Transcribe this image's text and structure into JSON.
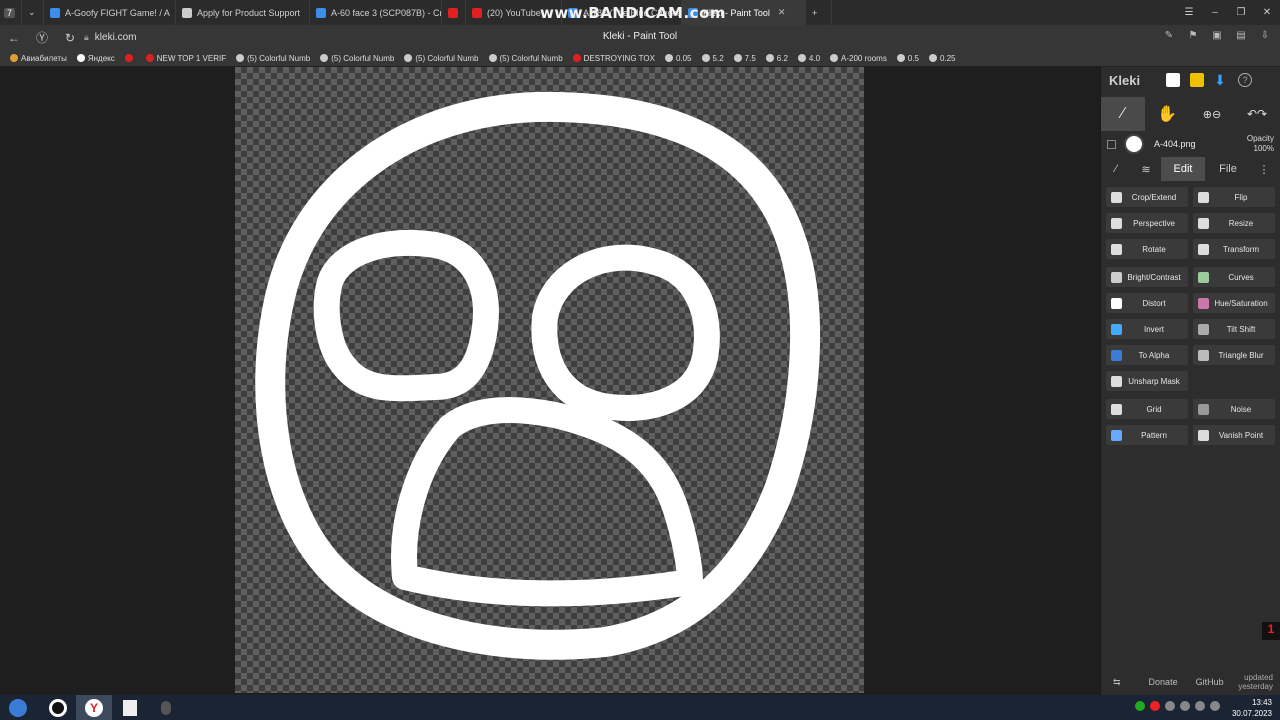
{
  "browser": {
    "tabs": [
      {
        "title": "A-Goofy FIGHT Game! / A",
        "color": "#3b8eea"
      },
      {
        "title": "Apply for Product Support",
        "color": "#cccccc"
      },
      {
        "title": "A-60 face 3 (SCP087B) - Cr",
        "color": "#3b8eea"
      },
      {
        "title": "",
        "color": "#e02020"
      },
      {
        "title": "(20) YouTube",
        "color": "#e02020"
      },
      {
        "title": "A-185 (The Blue Checker)",
        "color": "#3b8eea"
      },
      {
        "title": "Kleki - Paint Tool",
        "color": "#3b8eea"
      }
    ],
    "active_tab": "Kleki - Paint Tool",
    "watermark": "www.BANDICAM.com",
    "url": "kleki.com",
    "page_title": "Kleki - Paint Tool",
    "bookmarks": [
      {
        "label": "Авиабилеты",
        "color": "#e0a030"
      },
      {
        "label": "Яндекс",
        "color": "#ffffff"
      },
      {
        "label": "",
        "color": "#e02020"
      },
      {
        "label": "NEW TOP 1 VERIF",
        "color": "#e02020"
      },
      {
        "label": "(5) Colorful Numb",
        "color": "#cccccc"
      },
      {
        "label": "(5) Colorful Numb",
        "color": "#cccccc"
      },
      {
        "label": "(5) Colorful Numb",
        "color": "#cccccc"
      },
      {
        "label": "(5) Colorful Numb",
        "color": "#cccccc"
      },
      {
        "label": "DESTROYING TOX",
        "color": "#e02020"
      },
      {
        "label": "0.05",
        "color": "#cccccc"
      },
      {
        "label": "5.2",
        "color": "#cccccc"
      },
      {
        "label": "7.5",
        "color": "#cccccc"
      },
      {
        "label": "6.2",
        "color": "#cccccc"
      },
      {
        "label": "4.0",
        "color": "#cccccc"
      },
      {
        "label": "A-200 rooms",
        "color": "#cccccc"
      },
      {
        "label": "0.5",
        "color": "#cccccc"
      },
      {
        "label": "0.25",
        "color": "#cccccc"
      }
    ]
  },
  "kleki": {
    "logo": "Kleki",
    "layer": {
      "name": "A-404.png",
      "opacity_label": "Opacity",
      "opacity_value": "100%"
    },
    "tabs": {
      "edit": "Edit",
      "file": "File"
    },
    "filters": {
      "group1": [
        [
          "Crop/Extend",
          "Flip"
        ],
        [
          "Perspective",
          "Resize"
        ],
        [
          "Rotate",
          "Transform"
        ]
      ],
      "group2": [
        [
          "Bright/Contrast",
          "Curves"
        ],
        [
          "Distort",
          "Hue/Saturation"
        ],
        [
          "Invert",
          "Tilt Shift"
        ],
        [
          "To Alpha",
          "Triangle Blur"
        ],
        [
          "Unsharp Mask",
          ""
        ]
      ],
      "group3": [
        [
          "Grid",
          "Noise"
        ],
        [
          "Pattern",
          "Vanish Point"
        ]
      ]
    },
    "footer": {
      "donate": "Donate",
      "github": "GitHub",
      "updated_line1": "updated",
      "updated_line2": "yesterday"
    }
  },
  "taskbar": {
    "time": "13:43",
    "date": "30.07.2023"
  }
}
